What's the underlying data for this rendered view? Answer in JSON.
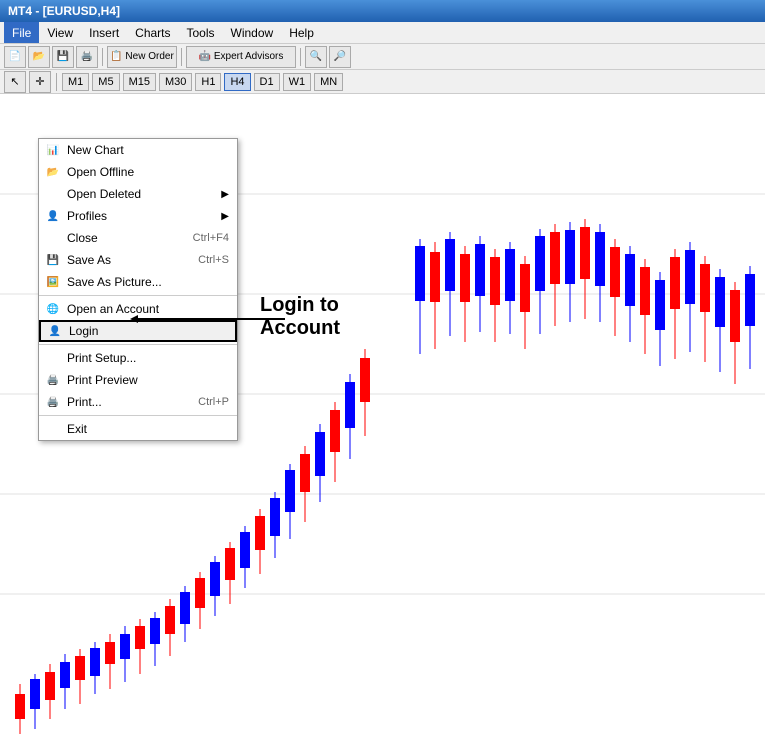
{
  "titleBar": {
    "text": "MT4 - [EURUSD,H4]"
  },
  "menuBar": {
    "items": [
      {
        "label": "File",
        "active": true
      },
      {
        "label": "View",
        "active": false
      },
      {
        "label": "Insert",
        "active": false
      },
      {
        "label": "Charts",
        "active": false
      },
      {
        "label": "Tools",
        "active": false
      },
      {
        "label": "Window",
        "active": false
      },
      {
        "label": "Help",
        "active": false
      }
    ]
  },
  "toolbar": {
    "buttons": [
      "📄",
      "📂",
      "💾",
      "🖨️"
    ],
    "newOrder": "New Order",
    "expertAdvisors": "Expert Advisors"
  },
  "timeframes": [
    "M1",
    "M5",
    "M15",
    "M30",
    "H1",
    "H4",
    "D1",
    "W1",
    "MN"
  ],
  "dropdown": {
    "items": [
      {
        "label": "New Chart",
        "icon": "📊",
        "shortcut": "",
        "arrow": false,
        "sep_after": false
      },
      {
        "label": "Open Offline",
        "icon": "📂",
        "shortcut": "",
        "arrow": false,
        "sep_after": false
      },
      {
        "label": "Open Deleted",
        "icon": "🗑️",
        "shortcut": "",
        "arrow": true,
        "sep_after": false
      },
      {
        "label": "Profiles",
        "icon": "👤",
        "shortcut": "",
        "arrow": true,
        "sep_after": false
      },
      {
        "label": "Close",
        "icon": "",
        "shortcut": "Ctrl+F4",
        "arrow": false,
        "sep_after": false
      },
      {
        "label": "Save As",
        "icon": "💾",
        "shortcut": "Ctrl+S",
        "arrow": false,
        "sep_after": false
      },
      {
        "label": "Save As Picture...",
        "icon": "🖼️",
        "shortcut": "",
        "arrow": false,
        "sep_after": true
      },
      {
        "label": "Open an Account",
        "icon": "🌐",
        "shortcut": "",
        "arrow": false,
        "sep_after": false
      },
      {
        "label": "Login",
        "icon": "👤",
        "shortcut": "",
        "arrow": false,
        "sep_after": true,
        "highlighted": true
      },
      {
        "label": "Print Setup...",
        "icon": "",
        "shortcut": "",
        "arrow": false,
        "sep_after": false
      },
      {
        "label": "Print Preview",
        "icon": "🖨️",
        "shortcut": "",
        "arrow": false,
        "sep_after": false
      },
      {
        "label": "Print...",
        "icon": "🖨️",
        "shortcut": "Ctrl+P",
        "arrow": false,
        "sep_after": true
      },
      {
        "label": "Exit",
        "icon": "",
        "shortcut": "",
        "arrow": false,
        "sep_after": false
      }
    ]
  },
  "annotation": {
    "line1": "Login to",
    "line2": "Account"
  },
  "colors": {
    "bullCandle": "#0000ff",
    "bearCandle": "#ff0000",
    "accent": "#316ac5"
  }
}
